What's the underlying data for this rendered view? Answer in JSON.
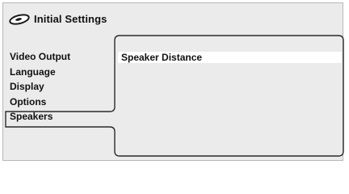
{
  "header": {
    "icon": "disc-icon",
    "title": "Initial Settings"
  },
  "menu": {
    "items": [
      {
        "label": "Video Output"
      },
      {
        "label": "Language"
      },
      {
        "label": "Display"
      },
      {
        "label": "Options"
      },
      {
        "label": "Speakers",
        "selected": true
      }
    ]
  },
  "panel": {
    "items": [
      {
        "label": "Speaker Distance",
        "highlighted": true
      }
    ]
  }
}
